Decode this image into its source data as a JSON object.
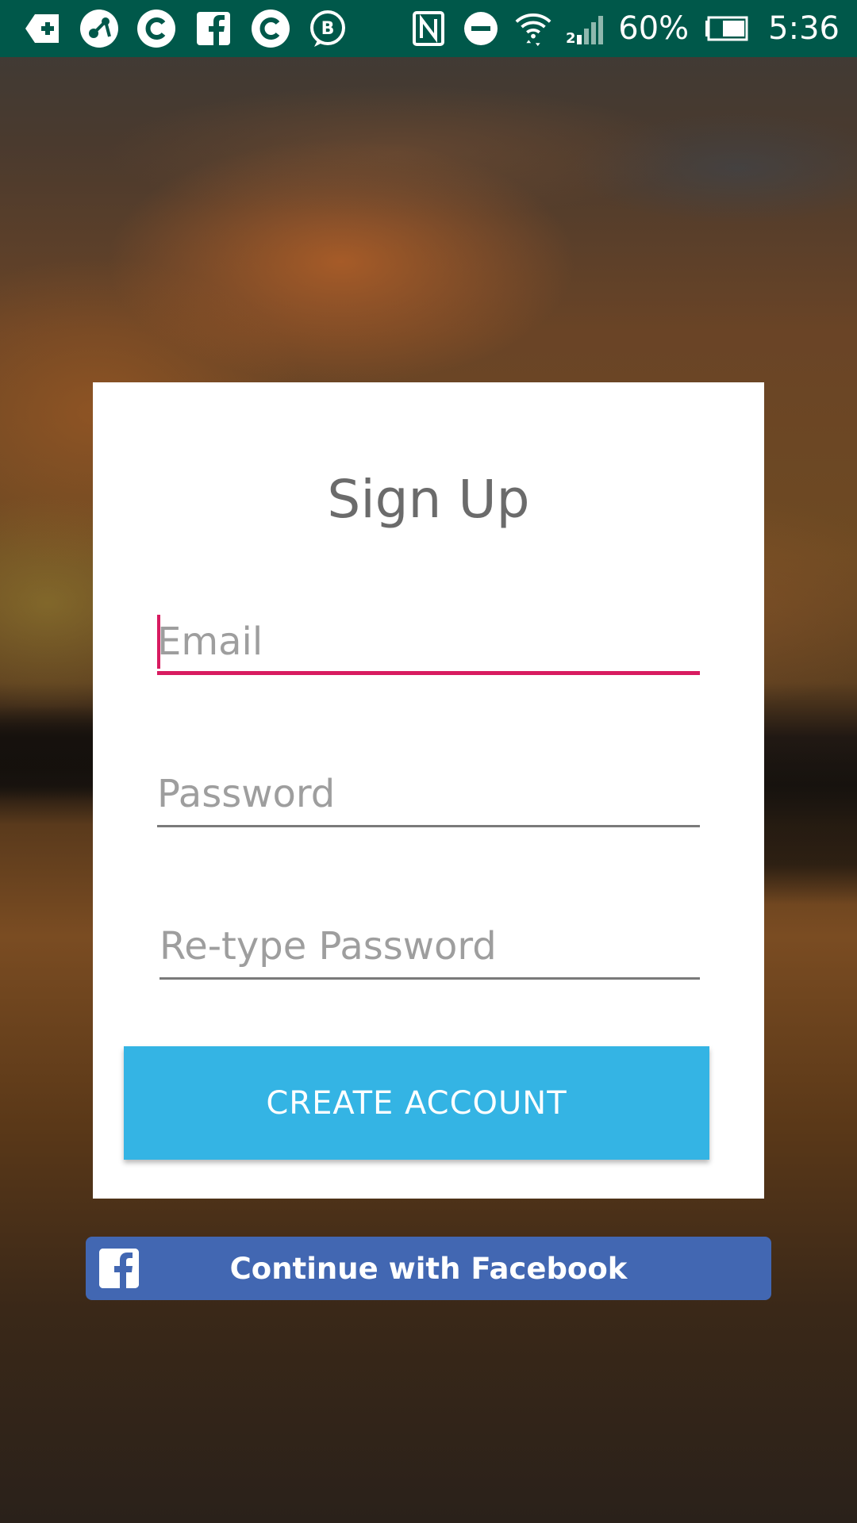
{
  "status_bar": {
    "battery_percent": "60%",
    "time": "5:36",
    "icons": [
      "add-cart-icon",
      "share-app-icon",
      "chat-app-icon",
      "facebook-icon",
      "chat-app-icon",
      "bbm-icon",
      "nfc-icon",
      "do-not-disturb-icon",
      "wifi-icon",
      "cell-signal-icon",
      "battery-icon"
    ],
    "background_color": "#00584a"
  },
  "signup": {
    "title": "Sign Up",
    "email": {
      "value": "",
      "placeholder": "Email"
    },
    "password": {
      "value": "",
      "placeholder": "Password"
    },
    "retype_password": {
      "value": "",
      "placeholder": "Re-type Password"
    },
    "create_button_label": "CREATE ACCOUNT"
  },
  "facebook": {
    "button_label": "Continue with Facebook"
  },
  "colors": {
    "accent_focus": "#d81b60",
    "create_button": "#34b4e4",
    "facebook_blue": "#4267b2",
    "title_gray": "#6b6b6b",
    "placeholder_gray": "#9e9e9e"
  }
}
